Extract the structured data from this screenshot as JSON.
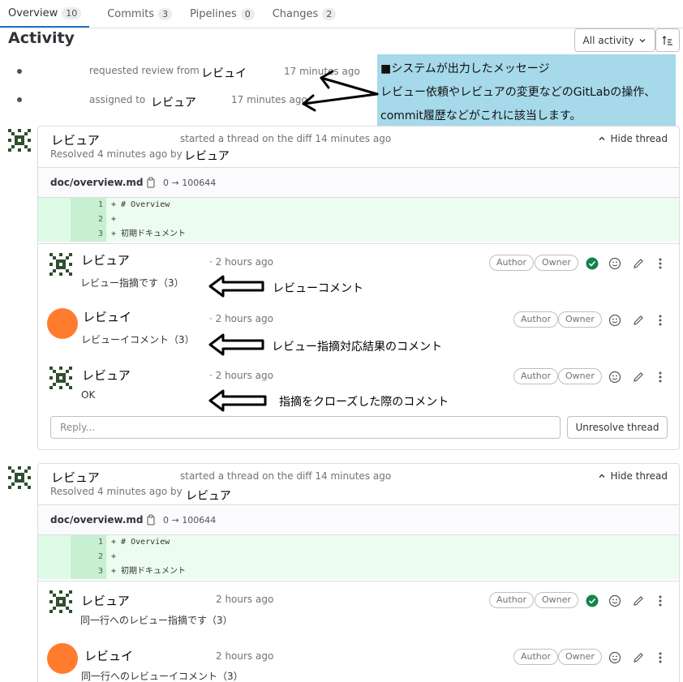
{
  "tabs": [
    {
      "label": "Overview",
      "count": "10"
    },
    {
      "label": "Commits",
      "count": "3"
    },
    {
      "label": "Pipelines",
      "count": "0"
    },
    {
      "label": "Changes",
      "count": "2"
    }
  ],
  "activity": {
    "title": "Activity",
    "filter_label": "All activity"
  },
  "system_notes": [
    {
      "text": "requested review from",
      "user": "レビュイ",
      "time": "17 minutes ago"
    },
    {
      "text": "assigned to",
      "user": "レビュア",
      "time": "17 minutes ago"
    }
  ],
  "callout": {
    "line1": "■システムが出力したメッセージ",
    "line2": "レビュー依頼やレビュアの変更などのGitLabの操作、",
    "line3": "commit履歴などがこれに該当します。"
  },
  "threads": [
    {
      "author": "レビュア",
      "started": "started a thread on the diff 14 minutes ago",
      "resolved": "Resolved 4 minutes ago by",
      "resolver": "レビュア",
      "hide_label": "Hide thread",
      "file": "doc/overview.md",
      "mode": "0 → 100644",
      "diff": [
        {
          "n": "1",
          "code": "+ # Overview"
        },
        {
          "n": "2",
          "code": "+"
        },
        {
          "n": "3",
          "code": "+ 初期ドキュメント"
        }
      ],
      "comments": [
        {
          "author": "レビュア",
          "time": "· 2 hours ago",
          "body": "レビュー指摘です（3）",
          "annotation": "レビューコメント"
        },
        {
          "author": "レビュイ",
          "time": "· 2 hours ago",
          "body": "レビューイコメント（3）",
          "annotation": "レビュー指摘対応結果のコメント"
        },
        {
          "author": "レビュア",
          "time": "· 2 hours ago",
          "body": "OK",
          "annotation": "指摘をクローズした際のコメント"
        }
      ],
      "reply_placeholder": "Reply...",
      "unresolve_label": "Unresolve thread"
    },
    {
      "author": "レビュア",
      "started": "started a thread on the diff 14 minutes ago",
      "resolved": "Resolved 4 minutes ago by",
      "resolver": "レビュア",
      "hide_label": "Hide thread",
      "file": "doc/overview.md",
      "mode": "0 → 100644",
      "diff": [
        {
          "n": "1",
          "code": "+ # Overview"
        },
        {
          "n": "2",
          "code": "+"
        },
        {
          "n": "3",
          "code": "+ 初期ドキュメント"
        }
      ],
      "comments": [
        {
          "author": "レビュア",
          "time": "2 hours ago",
          "body": "同一行へのレビュー指摘です（3）"
        },
        {
          "author": "レビュイ",
          "time": "2 hours ago",
          "body": "同一行へのレビューイコメント（3）"
        }
      ]
    }
  ],
  "badges": {
    "author": "Author",
    "owner": "Owner"
  },
  "colors": {
    "accent": "#1f75cb",
    "resolved": "#108548",
    "callout": "#a6d9ea",
    "avatar_orange": "#ff7c2e",
    "diff_added": "#ecfdf0"
  }
}
